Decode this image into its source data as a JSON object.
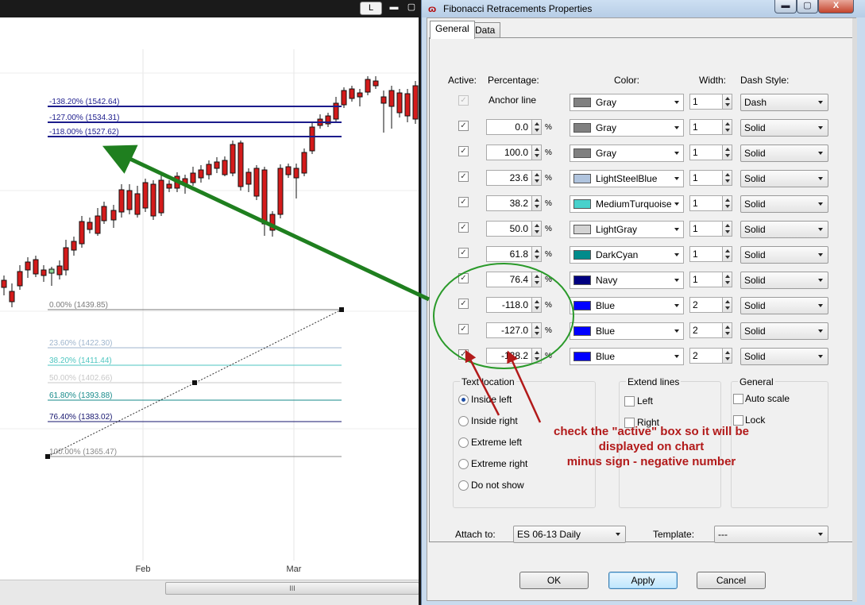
{
  "chart": {
    "topbar_button": "L",
    "scroll_thumb_label": "III",
    "x_labels": [
      "Feb",
      "Mar"
    ],
    "fib_levels": [
      {
        "label": "-138.20% (1542.64)",
        "color": "#1c1c8c"
      },
      {
        "label": "-127.00% (1534.31)",
        "color": "#1c1c8c"
      },
      {
        "label": "-118.00% (1527.62)",
        "color": "#1c1c8c"
      },
      {
        "label": "0.00% (1439.85)",
        "color": "#7a7a7a"
      },
      {
        "label": "23.60% (1422.30)",
        "color": "#9fb5cd"
      },
      {
        "label": "38.20% (1411.44)",
        "color": "#4ec6c0"
      },
      {
        "label": "50.00% (1402.66)",
        "color": "#c8c8c8"
      },
      {
        "label": "61.80% (1393.88)",
        "color": "#168a8a"
      },
      {
        "label": "76.40% (1383.02)",
        "color": "#14146e"
      },
      {
        "label": "100.00% (1365.47)",
        "color": "#8a8a8a"
      }
    ]
  },
  "dialog": {
    "title": "Fibonacci Retracements Properties",
    "window_buttons": {
      "minimize": "▬",
      "maximize": "▢",
      "close": "X"
    },
    "tabs": [
      {
        "label": "General",
        "active": true
      },
      {
        "label": "Data",
        "active": false
      }
    ],
    "headers": {
      "active": "Active:",
      "percentage": "Percentage:",
      "color": "Color:",
      "width": "Width:",
      "dash_style": "Dash Style:"
    },
    "anchor_row": {
      "label": "Anchor line",
      "color": "Gray",
      "swatch": "#808080",
      "width": "1",
      "dash": "Dash",
      "checked": true
    },
    "percent_sign": "%",
    "check_mark": "✓",
    "levels": [
      {
        "percentage": "0.0",
        "color": "Gray",
        "swatch": "#808080",
        "width": "1",
        "dash": "Solid"
      },
      {
        "percentage": "100.0",
        "color": "Gray",
        "swatch": "#808080",
        "width": "1",
        "dash": "Solid"
      },
      {
        "percentage": "23.6",
        "color": "LightSteelBlue",
        "swatch": "#b0c4de",
        "width": "1",
        "dash": "Solid"
      },
      {
        "percentage": "38.2",
        "color": "MediumTurquoise",
        "swatch": "#48d1cc",
        "width": "1",
        "dash": "Solid"
      },
      {
        "percentage": "50.0",
        "color": "LightGray",
        "swatch": "#d3d3d3",
        "width": "1",
        "dash": "Solid"
      },
      {
        "percentage": "61.8",
        "color": "DarkCyan",
        "swatch": "#008b8b",
        "width": "1",
        "dash": "Solid"
      },
      {
        "percentage": "76.4",
        "color": "Navy",
        "swatch": "#000080",
        "width": "1",
        "dash": "Solid"
      },
      {
        "percentage": "-118.0",
        "color": "Blue",
        "swatch": "#0000ff",
        "width": "2",
        "dash": "Solid"
      },
      {
        "percentage": "-127.0",
        "color": "Blue",
        "swatch": "#0000ff",
        "width": "2",
        "dash": "Solid"
      },
      {
        "percentage": "-138.2",
        "color": "Blue",
        "swatch": "#0000ff",
        "width": "2",
        "dash": "Solid"
      }
    ],
    "text_location": {
      "title": "Text location",
      "options": [
        "Inside left",
        "Inside right",
        "Extreme left",
        "Extreme right",
        "Do not show"
      ],
      "selected": "Inside left"
    },
    "extend_lines": {
      "title": "Extend lines",
      "options": [
        "Left",
        "Right"
      ]
    },
    "general": {
      "title": "General",
      "options": [
        "Auto scale",
        "Lock"
      ]
    },
    "attach_to": {
      "label": "Attach to:",
      "value": "ES 06-13 Daily"
    },
    "template": {
      "label": "Template:",
      "value": "---"
    },
    "buttons": {
      "ok": "OK",
      "apply": "Apply",
      "cancel": "Cancel"
    }
  },
  "annotation": {
    "line1": "check the \"active\" box so it will be",
    "line2": "displayed on chart",
    "line3": "minus sign - negative number",
    "text_color": "#b21a1a",
    "arrow_color": "#1f7f1f",
    "ellipse_color": "#2a9a2a"
  }
}
